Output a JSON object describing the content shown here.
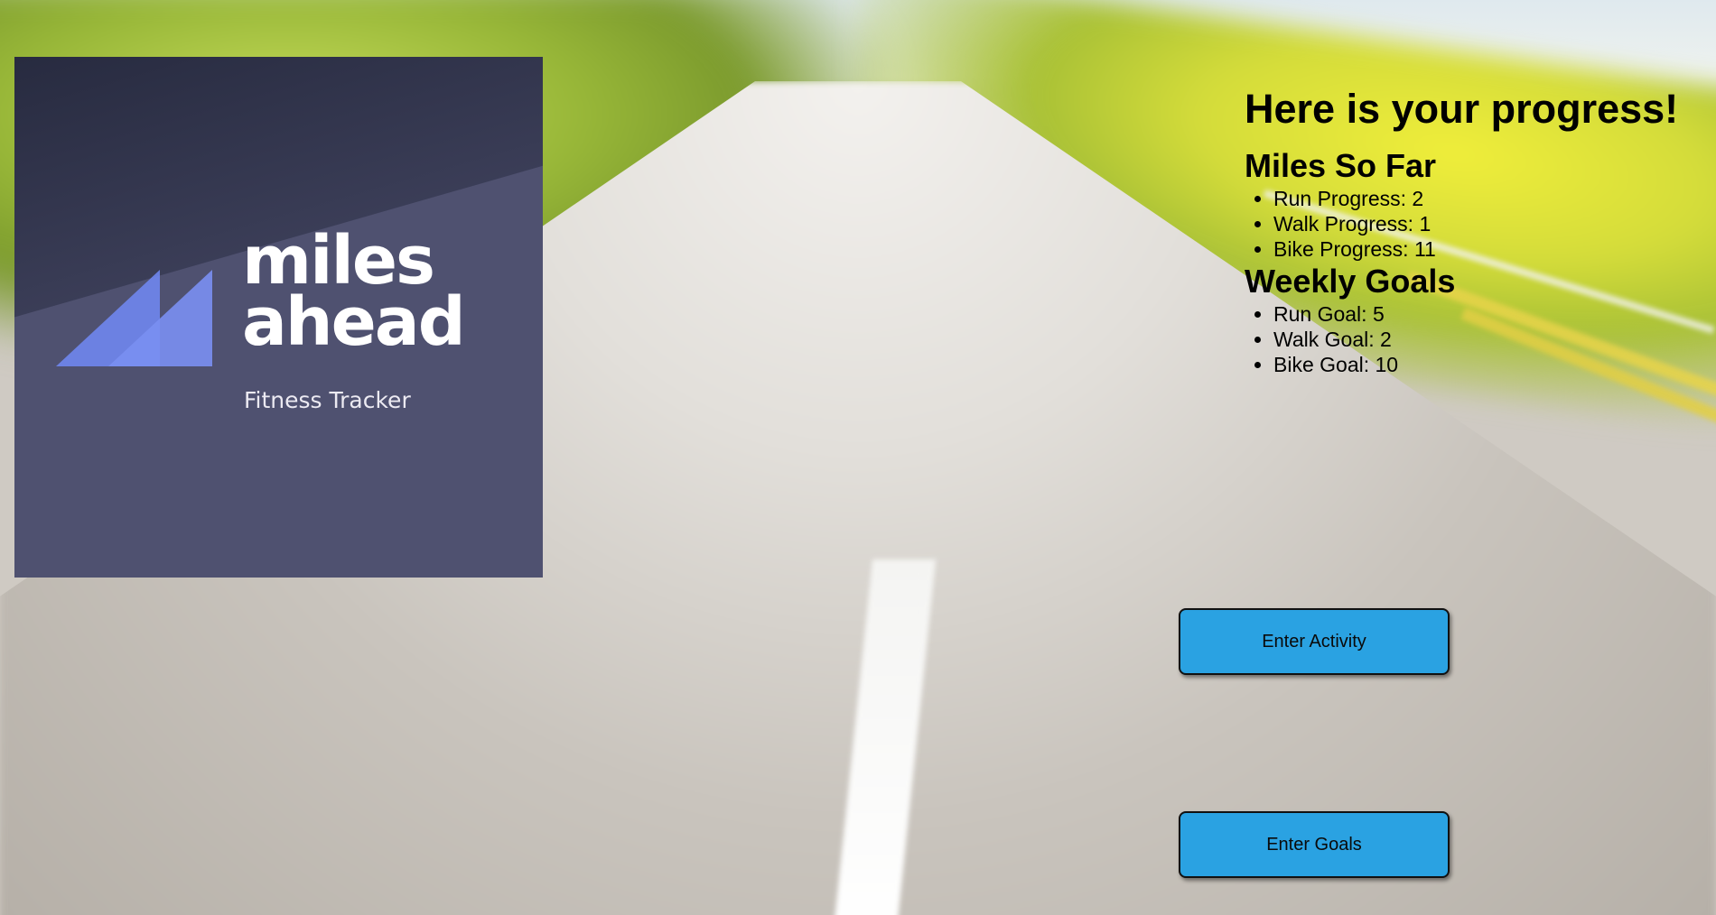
{
  "logo": {
    "word_line_1": "miles",
    "word_line_2": "ahead",
    "tagline": "Fitness Tracker",
    "panel_color": "#4f5170",
    "mark_color": "#6f86ee"
  },
  "progress": {
    "title": "Here is your progress!",
    "miles_heading": "Miles So Far",
    "miles_items": [
      {
        "label": "Run Progress: 2"
      },
      {
        "label": "Walk Progress: 1"
      },
      {
        "label": "Bike Progress: 11"
      }
    ],
    "goals_heading": "Weekly Goals",
    "goals_items": [
      {
        "label": "Run Goal: 5"
      },
      {
        "label": "Walk Goal: 2"
      },
      {
        "label": "Bike Goal: 10"
      }
    ]
  },
  "actions": {
    "enter_activity_label": "Enter Activity",
    "enter_goals_label": "Enter Goals",
    "button_color": "#2aa2e2"
  }
}
